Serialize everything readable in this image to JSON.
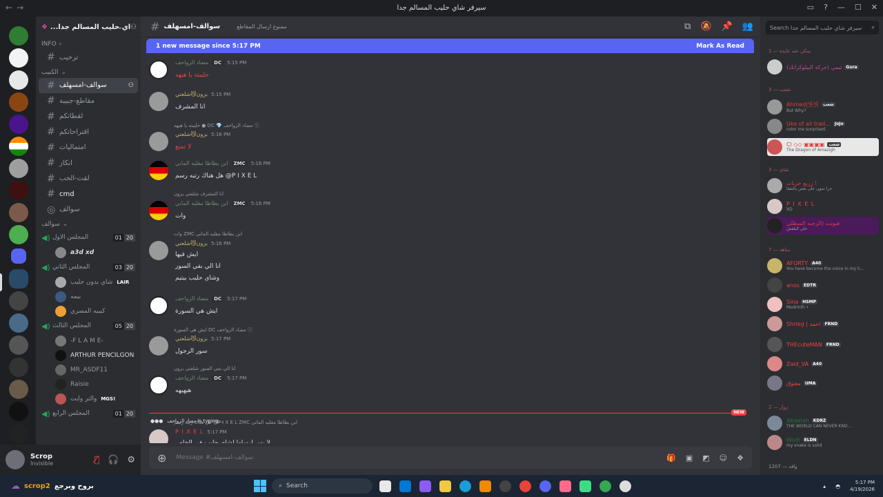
{
  "window": {
    "title": "سيرفر شاي حليب المسالم جدا",
    "back": "←",
    "forward": "→",
    "controls": [
      "▭",
      "?",
      "—",
      "☐",
      "✕"
    ]
  },
  "server": {
    "name": "سيرفر شاي حليب المسالم جدا",
    "short_name": "...اي حليب المسالم جدا"
  },
  "channels": {
    "info_category": "INFO",
    "info_channel": "ترحيب",
    "cat2": "الكبيب",
    "items": [
      "سوالف-امسهلف",
      "مقاطع-جبيبة",
      "لقطاتكم",
      "اقتراحاتكم",
      "امتمالیات",
      "انکاز",
      "لقت-الحب",
      "cmd",
      "سوالف"
    ],
    "voice_category": "سوالف",
    "voice": [
      {
        "name": "المجلس الاول",
        "a": "01",
        "b": "20",
        "users": [
          {
            "name": "a3d xd",
            "badge": ""
          }
        ]
      },
      {
        "name": "المجلس الثاني",
        "a": "03",
        "b": "20",
        "users": [
          {
            "name": "شاي بدون حليب",
            "badge": "LAIR"
          },
          {
            "name": "نيمه",
            "badge": ""
          },
          {
            "name": "كيبيه المصري",
            "badge": ""
          }
        ]
      },
      {
        "name": "المجلس الثالث",
        "a": "05",
        "b": "20",
        "users": [
          {
            "name": "-F L A M E-",
            "badge": ""
          },
          {
            "name": "ARTHUR PENCILGON",
            "badge": ""
          },
          {
            "name": "MR_ASDF11",
            "badge": ""
          },
          {
            "name": "Raisie",
            "badge": ""
          },
          {
            "name": "والتر وایت",
            "badge": "MGS!"
          }
        ]
      },
      {
        "name": "المجلس الرابع",
        "a": "01",
        "b": "20",
        "users": []
      }
    ]
  },
  "user_panel": {
    "name": "Scrop",
    "status": "Invisible"
  },
  "header": {
    "channel": "سوالف-امسهلف",
    "topic": "ممنوع ارسال المقاطع"
  },
  "new_banner": {
    "text": "1 new message since 5:17 PM",
    "mark": "Mark As Read"
  },
  "messages": [
    {
      "reply": "",
      "user": "مضاد الزواحف",
      "tag": "DC",
      "time": "5:15 PM",
      "lines": [
        "حليبته يا هيهه"
      ],
      "color": "#5e8f5e",
      "body_color": "#f23f43"
    },
    {
      "reply": "",
      "user": "بزون😼شلعتي",
      "tag": "",
      "time": "5:15 PM",
      "lines": [
        "انا المشرف"
      ],
      "color": "#a08c5a"
    },
    {
      "reply": "حليبته يا هيهه ● DC 💎 مضاد الزواحف ⓘ",
      "user": "بزون😼شلعتي",
      "tag": "",
      "time": "5:16 PM",
      "lines": [
        "لا تمنع"
      ],
      "color": "#a08c5a",
      "body_color": "#f23f43"
    },
    {
      "reply": "",
      "user": "ابن بطاطا مقليه الماني",
      "tag": "ZMC",
      "time": "5:16 PM",
      "lines": [
        "هل هناك رتبه رسم @P I X E L"
      ],
      "color": "#5e8f5e"
    },
    {
      "reply": "انا المشرف شلعتي بزون",
      "user": "ابن بطاطا مقليه الماني",
      "tag": "ZMC",
      "time": "5:16 PM",
      "lines": [
        "وات"
      ],
      "color": "#5e8f5e"
    },
    {
      "reply": "وات ZMC ابن بطاطا مقليه الماني",
      "user": "بزون😼شلعتي",
      "tag": "",
      "time": "5:16 PM",
      "lines": [
        "ايش فيها",
        "انا الي بفي السور",
        "وشاي حليب بيتيم"
      ],
      "color": "#a08c5a"
    },
    {
      "reply": "",
      "user": "مضاد الزواحف",
      "tag": "DC",
      "time": "5:17 PM",
      "lines": [
        "ايش هي السورة"
      ],
      "color": "#5e8f5e"
    },
    {
      "reply": "ايش هي السورة DC مضاد الزواحف ⓘ",
      "user": "بزون😼شلعتي",
      "tag": "",
      "time": "5:17 PM",
      "lines": [
        "سور الرجول"
      ],
      "color": "#a08c5a"
    },
    {
      "reply": "انا الي بفي السور شلعتي بزون",
      "user": "مضاد الزواحف",
      "tag": "DC",
      "time": "5:17 PM",
      "lines": [
        "هيهيهه"
      ],
      "color": "#5e8f5e"
    },
    {
      "reply": "هل هناك رتبه رسم @P I X E L ZMC ابن بطاطا مقليه الماني",
      "user": "P I X E L",
      "tag": "",
      "time": "5:17 PM",
      "lines": [
        "لا بس ارسلها لشاي حليب في الخاص"
      ],
      "color": "#f23f43"
    }
  ],
  "new_label": "NEW",
  "typing": "مضاد الزواحف is typing...",
  "composer": {
    "placeholder": "Message #سوالف-امسهلف"
  },
  "member_search": {
    "placeholder": "Search سيرفر شاي حليب المسالم جدا"
  },
  "member_sections": [
    "يمكن عنه عايدة — 1",
    "شعب — 3",
    "شاي — 3",
    "ساهد — 7",
    "زوار — 2",
    "1207 — وافد"
  ],
  "members": [
    {
      "name": "(تيمي (حركة البيلوكرانك",
      "tag": "Gura",
      "status": "",
      "color": "#c7469b"
    },
    {
      "name": "Ahmed|卐卐",
      "tag": "شعب",
      "status": "But Why?",
      "color": "#e33c3c"
    },
    {
      "name": "Uke of all trad...",
      "tag": "JoJo",
      "status": "color me surprised.",
      "color": "#e33c3c"
    },
    {
      "name": "Cl ◇◇ ▣▣▣▣",
      "tag": "شعب",
      "status": "The Dragon of Amazigh",
      "color": "#e33c3c"
    },
    {
      "name": "زريع حزبات !",
      "tag": "",
      "status": "حرا نمون على بعض يالتفقا",
      "color": "#e33c3c"
    },
    {
      "name": "P I X E L",
      "tag": "",
      "status": "XD",
      "color": "#f23f43"
    },
    {
      "name": "فيوتت (الرجبه السطلي",
      "tag": "",
      "status": "حلي اليلقش",
      "color": "#e33c3c"
    },
    {
      "name": "AFORTY",
      "tag": "A40",
      "status": "You have become the voice in my h...",
      "color": "#f23f43"
    },
    {
      "name": "anos",
      "tag": "EDTR",
      "status": "",
      "color": "#f23f43"
    },
    {
      "name": "Sina",
      "tag": "HSMP",
      "status": "Modrinth •",
      "color": "#f23f43"
    },
    {
      "name": "Shrieg | احمد",
      "tag": "FRND",
      "status": "",
      "color": "#f23f43"
    },
    {
      "name": "THEcuteMAN",
      "tag": "FRND",
      "status": "",
      "color": "#f23f43"
    },
    {
      "name": "Zaid_VA",
      "tag": "A40",
      "status": "",
      "color": "#f23f43"
    },
    {
      "name": "معتوق",
      "tag": "UMA",
      "status": "",
      "color": "#f23f43"
    },
    {
      "name": "Abdelah",
      "tag": "KDRZ",
      "status": "THE WORLD CAN NEVER KNO...",
      "color": "#2f6f3a"
    },
    {
      "name": "Wodi",
      "tag": "ELDN",
      "status": "my snake is solid",
      "color": "#2f6f3a"
    }
  ],
  "taskbar": {
    "user": "scrop2",
    "text": "بروح وبرجع",
    "search": "Search",
    "time": "5:17 PM",
    "date": "4/19/2026"
  }
}
